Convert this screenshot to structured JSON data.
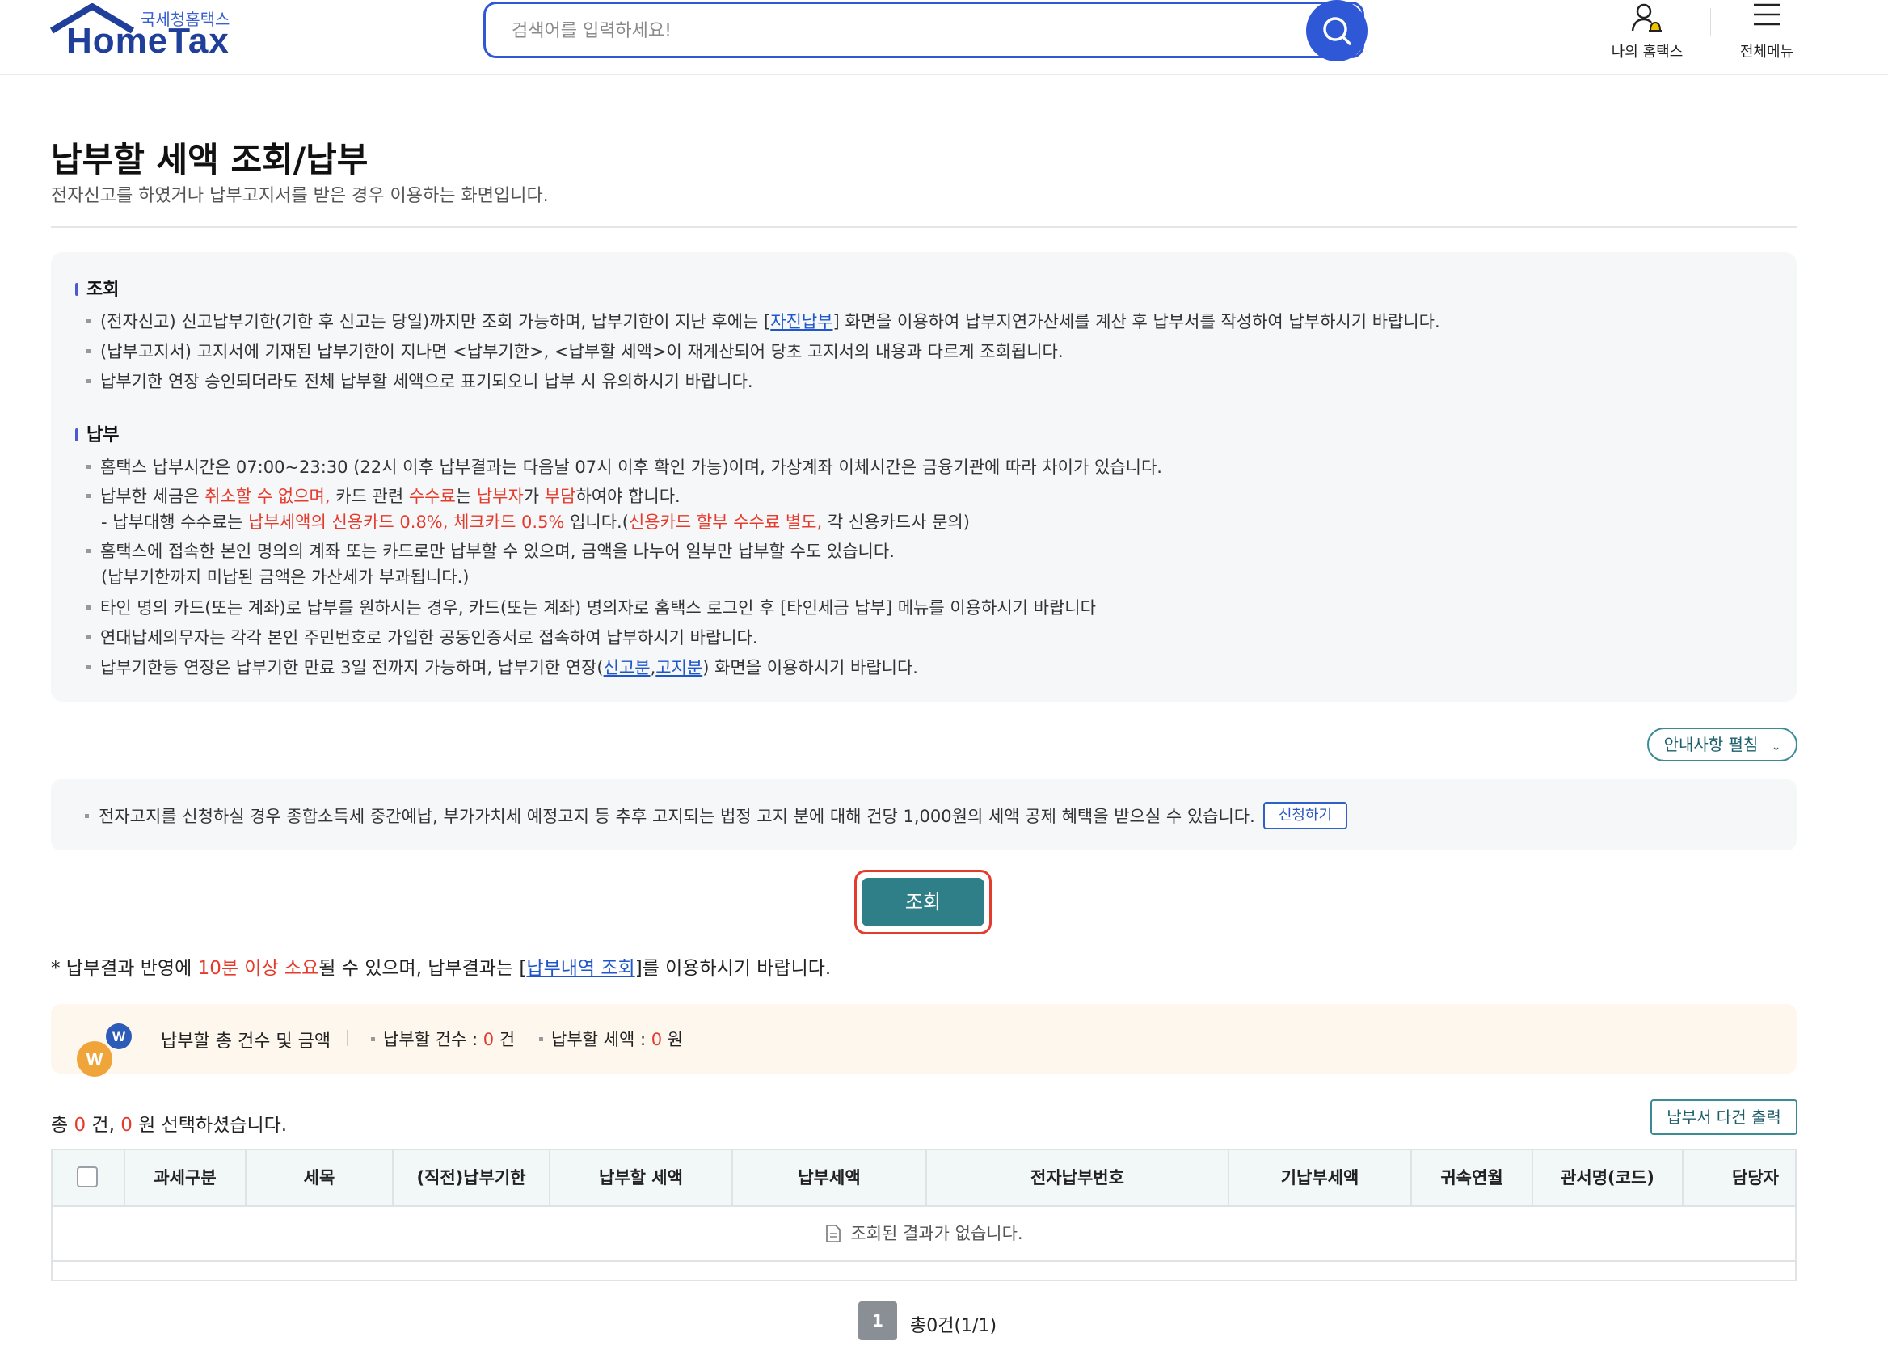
{
  "header": {
    "logo_small": "국세청홈택스",
    "logo_big": "HomeTax",
    "search_placeholder": "검색어를 입력하세요!",
    "my_hometax": "나의 홈택스",
    "all_menu": "전체메뉴"
  },
  "page": {
    "title": "납부할 세액 조회/납부",
    "subtitle": "전자신고를 하였거나 납부고지서를 받은 경우 이용하는 화면입니다."
  },
  "info": {
    "section1_title": "조회",
    "s1_line1_a": "(전자신고) 신고납부기한(기한 후 신고는 당일)까지만 조회 가능하며, 납부기한이 지난 후에는 [",
    "s1_line1_link": "자진납부",
    "s1_line1_b": "] 화면을 이용하여 납부지연가산세를 계산 후 납부서를 작성하여 납부하시기 바랍니다.",
    "s1_line2": "(납부고지서) 고지서에 기재된 납부기한이 지나면 <납부기한>, <납부할 세액>이 재계산되어 당초 고지서의 내용과 다르게 조회됩니다.",
    "s1_line3": "납부기한 연장 승인되더라도 전체 납부할 세액으로 표기되오니 납부 시 유의하시기 바랍니다.",
    "section2_title": "납부",
    "s2_line1": "홈택스 납부시간은 07:00~23:30 (22시 이후 납부결과는 다음날 07시 이후 확인 가능)이며, 가상계좌 이체시간은 금융기관에 따라 차이가 있습니다.",
    "s2_line2_a": "납부한 세금은 ",
    "s2_line2_b": "취소할 수 없으며,",
    "s2_line2_c": " 카드 관련 ",
    "s2_line2_d": "수수료",
    "s2_line2_e": "는 ",
    "s2_line2_f": "납부자",
    "s2_line2_g": "가 ",
    "s2_line2_h": "부담",
    "s2_line2_i": "하여야 합니다.",
    "s2_line3_a": "- 납부대행 수수료는 ",
    "s2_line3_b": "납부세액의 신용카드 0.8%, 체크카드 0.5%",
    "s2_line3_c": " 입니다.(",
    "s2_line3_d": "신용카드 할부 수수료 별도,",
    "s2_line3_e": " 각 신용카드사 문의)",
    "s2_line4": "홈택스에 접속한 본인 명의의 계좌 또는 카드로만 납부할 수 있으며, 금액을 나누어 일부만 납부할 수도 있습니다.",
    "s2_line5": "(납부기한까지 미납된 금액은 가산세가 부과됩니다.)",
    "s2_line6": "타인 명의 카드(또는 계좌)로 납부를 원하시는 경우, 카드(또는 계좌) 명의자로 홈택스 로그인 후 [타인세금 납부] 메뉴를 이용하시기 바랍니다",
    "s2_line7": "연대납세의무자는 각각 본인 주민번호로 가입한 공동인증서로 접속하여 납부하시기 바랍니다.",
    "s2_line8_a": "납부기한등 연장은 납부기한 만료 3일 전까지 가능하며, 납부기한 연장(",
    "s2_line8_link1": "신고분",
    "s2_line8_comma": ",",
    "s2_line8_link2": "고지분",
    "s2_line8_b": ") 화면을 이용하시기 바랍니다."
  },
  "expand_label": "안내사항 펼침",
  "enotice": {
    "text": "전자고지를 신청하실 경우 종합소득세 중간예납, 부가가치세 예정고지 등 추후 고지되는 법정 고지 분에 대해 건당 1,000원의 세액 공제 혜택을 받으실 수 있습니다.",
    "apply_label": "신청하기"
  },
  "query_label": "조회",
  "result_note": {
    "a": "* 납부결과 반영에 ",
    "b": "10분 이상 소요",
    "c": "될 수 있으며, 납부결과는 [",
    "link": "납부내역 조회",
    "d": "]를 이용하시기 바랍니다."
  },
  "summary": {
    "title": "납부할 총 건수 및 금액",
    "count_label": "납부할 건수 : ",
    "count_value": "0",
    "count_unit": " 건",
    "amount_label": "납부할 세액 : ",
    "amount_value": "0",
    "amount_unit": " 원"
  },
  "selection": {
    "a": "총 ",
    "count": "0",
    "b": " 건, ",
    "amount": "0",
    "c": " 원 선택하셨습니다."
  },
  "print_label": "납부서 다건 출력",
  "table": {
    "columns": [
      "과세구분",
      "세목",
      "(직전)납부기한",
      "납부할 세액",
      "납부세액",
      "전자납부번호",
      "기납부세액",
      "귀속연월",
      "관서명(코드)",
      "담당자"
    ],
    "empty_text": "조회된 결과가 없습니다."
  },
  "pagination": {
    "current": "1",
    "total": "총0건(1/1)"
  },
  "colors": {
    "primary_blue": "#2f58d6",
    "teal": "#2f7f88",
    "highlight_red": "#e43b2f"
  }
}
